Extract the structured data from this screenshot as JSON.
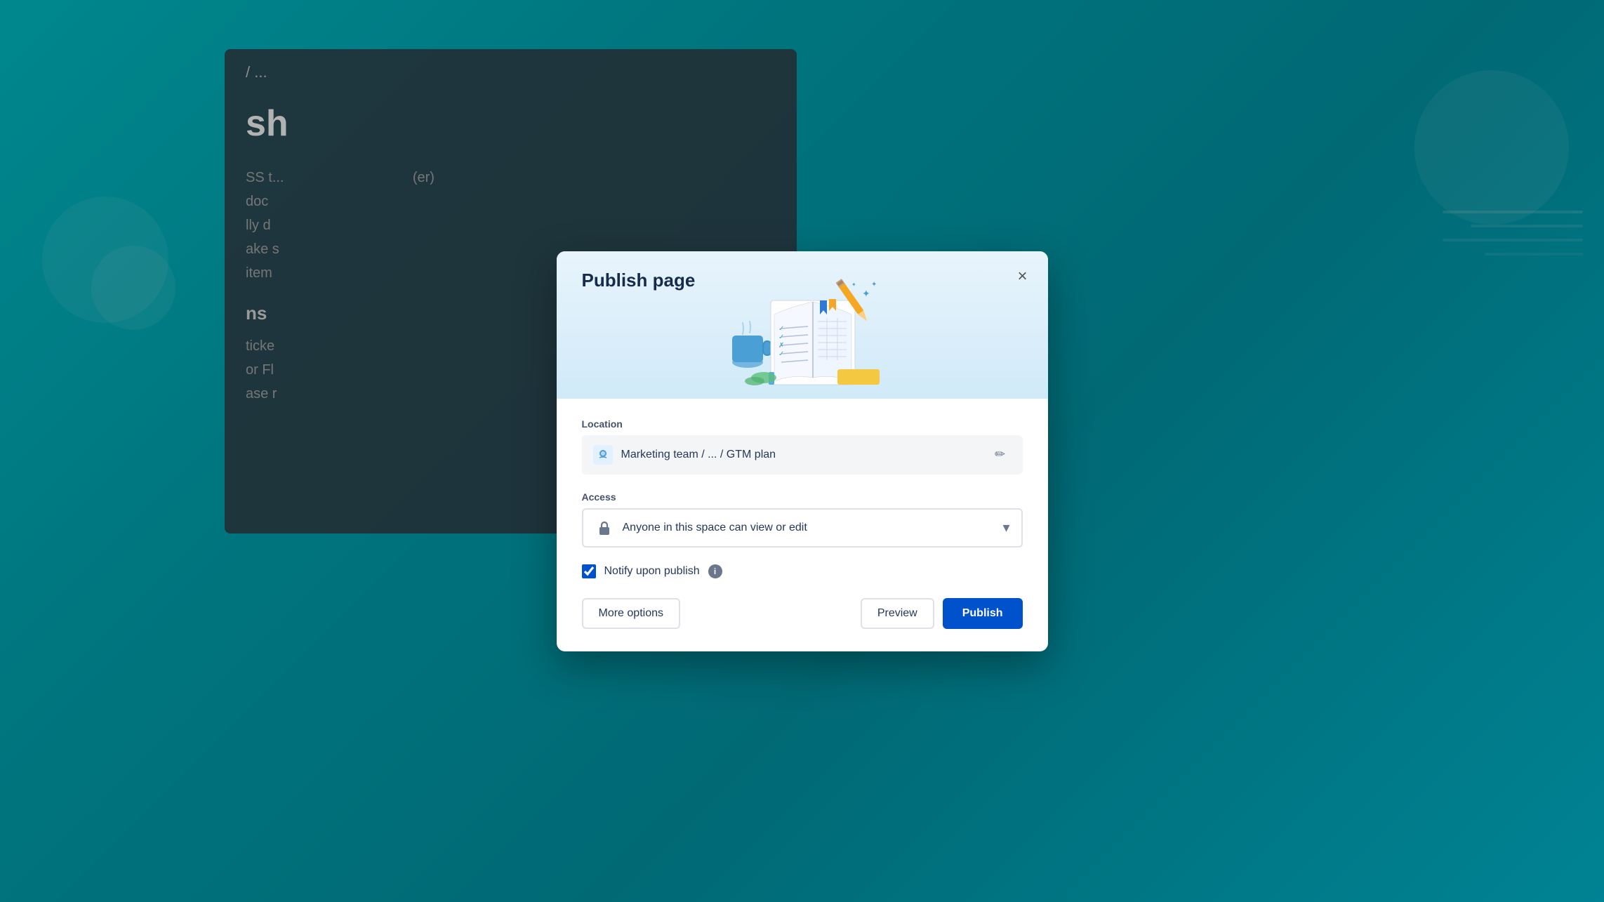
{
  "background": {
    "color_start": "#00c2cc",
    "color_end": "#0097a7"
  },
  "editor": {
    "breadcrumb": "/ ...",
    "title_partial": "sh",
    "body_lines": [
      "SS t... (er)",
      "doc",
      "lly d",
      "ake s",
      "item"
    ],
    "heading": "ns",
    "body2_lines": [
      "ticke",
      "or Fl",
      "ase r"
    ]
  },
  "modal": {
    "title": "Publish page",
    "close_label": "×",
    "location": {
      "label": "Location",
      "space_name": "Marketing team",
      "separator1": "/",
      "ellipsis": "...",
      "separator2": "/",
      "page_name": "GTM plan",
      "edit_icon": "✏"
    },
    "access": {
      "label": "Access",
      "text": "Anyone in this space can view or edit",
      "chevron": "▾"
    },
    "notify": {
      "label": "Notify upon publish",
      "checked": true,
      "info_label": "i"
    },
    "buttons": {
      "more_options": "More options",
      "preview": "Preview",
      "publish": "Publish"
    }
  }
}
